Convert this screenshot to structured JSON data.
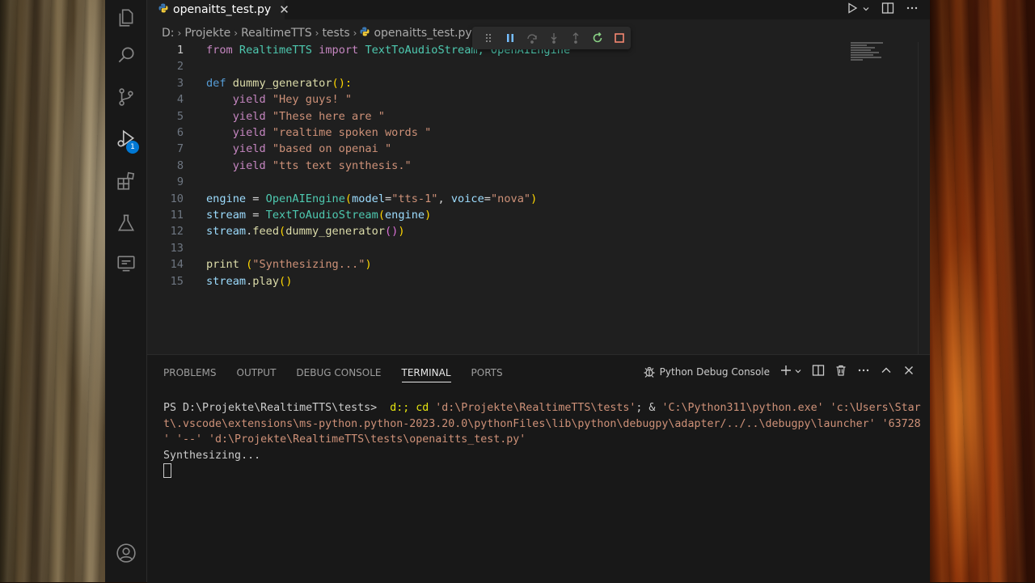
{
  "editor": {
    "tab_label": "openaitts_test.py",
    "tab_close": "✕",
    "breadcrumb": [
      "D:",
      "Projekte",
      "RealtimeTTS",
      "tests",
      "openaitts_test.py"
    ],
    "code": [
      {
        "n": "1",
        "segs": [
          [
            "from ",
            "kw"
          ],
          [
            "RealtimeTTS ",
            "cls"
          ],
          [
            "import ",
            "kw"
          ],
          [
            "TextToAudioStream, OpenAIEngine",
            "cls"
          ]
        ]
      },
      {
        "n": "2",
        "segs": []
      },
      {
        "n": "3",
        "segs": [
          [
            "def ",
            "kwb"
          ],
          [
            "dummy_generator",
            "fn"
          ],
          [
            "():",
            "p1"
          ]
        ]
      },
      {
        "n": "4",
        "segs": [
          [
            "    yield ",
            "kw"
          ],
          [
            "\"Hey guys! \"",
            "str"
          ]
        ]
      },
      {
        "n": "5",
        "segs": [
          [
            "    yield ",
            "kw"
          ],
          [
            "\"These here are \"",
            "str"
          ]
        ]
      },
      {
        "n": "6",
        "segs": [
          [
            "    yield ",
            "kw"
          ],
          [
            "\"realtime spoken words \"",
            "str"
          ]
        ]
      },
      {
        "n": "7",
        "segs": [
          [
            "    yield ",
            "kw"
          ],
          [
            "\"based on openai \"",
            "str"
          ]
        ]
      },
      {
        "n": "8",
        "segs": [
          [
            "    yield ",
            "kw"
          ],
          [
            "\"tts text synthesis.\"",
            "str"
          ]
        ]
      },
      {
        "n": "9",
        "segs": []
      },
      {
        "n": "10",
        "segs": [
          [
            "engine",
            "var"
          ],
          [
            " = ",
            ""
          ],
          [
            "OpenAIEngine",
            "cls"
          ],
          [
            "(",
            "p1"
          ],
          [
            "model",
            "var"
          ],
          [
            "=",
            ""
          ],
          [
            "\"tts-1\"",
            "str"
          ],
          [
            ", ",
            ""
          ],
          [
            "voice",
            "var"
          ],
          [
            "=",
            ""
          ],
          [
            "\"nova\"",
            "str"
          ],
          [
            ")",
            "p1"
          ]
        ]
      },
      {
        "n": "11",
        "segs": [
          [
            "stream",
            "var"
          ],
          [
            " = ",
            ""
          ],
          [
            "TextToAudioStream",
            "cls"
          ],
          [
            "(",
            "p1"
          ],
          [
            "engine",
            "var"
          ],
          [
            ")",
            "p1"
          ]
        ]
      },
      {
        "n": "12",
        "segs": [
          [
            "stream",
            "var"
          ],
          [
            ".",
            ""
          ],
          [
            "feed",
            "fn"
          ],
          [
            "(",
            "p1"
          ],
          [
            "dummy_generator",
            "fn"
          ],
          [
            "()",
            "p2"
          ],
          [
            ")",
            "p1"
          ]
        ]
      },
      {
        "n": "13",
        "segs": []
      },
      {
        "n": "14",
        "segs": [
          [
            "print ",
            "fn"
          ],
          [
            "(",
            "p1"
          ],
          [
            "\"Synthesizing...\"",
            "str"
          ],
          [
            ")",
            "p1"
          ]
        ]
      },
      {
        "n": "15",
        "segs": [
          [
            "stream",
            "var"
          ],
          [
            ".",
            ""
          ],
          [
            "play",
            "fn"
          ],
          [
            "()",
            "p1"
          ]
        ]
      }
    ]
  },
  "panel": {
    "tabs": [
      "PROBLEMS",
      "OUTPUT",
      "DEBUG CONSOLE",
      "TERMINAL",
      "PORTS"
    ],
    "active_tab": "TERMINAL",
    "console_name": "Python Debug Console",
    "terminal_lines": [
      [
        [
          "PS D:\\Projekte\\RealtimeTTS\\tests>  ",
          ""
        ],
        [
          "d:; cd ",
          "t-cmd"
        ],
        [
          "'d:\\Projekte\\RealtimeTTS\\tests'",
          "t-str"
        ],
        [
          "; & ",
          ""
        ],
        [
          "'C:\\Python311\\python.exe' 'c:\\Users\\Star",
          "t-str"
        ]
      ],
      [
        [
          "t\\.vscode\\extensions\\ms-python.python-2023.20.0\\pythonFiles\\lib\\python\\debugpy\\adapter/../..\\debugpy\\launcher' '63728",
          "t-str"
        ]
      ],
      [
        [
          "' '--' 'd:\\Projekte\\RealtimeTTS\\tests\\openaitts_test.py'",
          "t-str"
        ]
      ],
      [
        [
          "Synthesizing...",
          ""
        ]
      ]
    ]
  },
  "activity": {
    "debug_badge": "1"
  },
  "colors": {
    "editor_bg": "#1f1f1f",
    "panel_bg": "#181818",
    "accent": "#0078d4"
  }
}
